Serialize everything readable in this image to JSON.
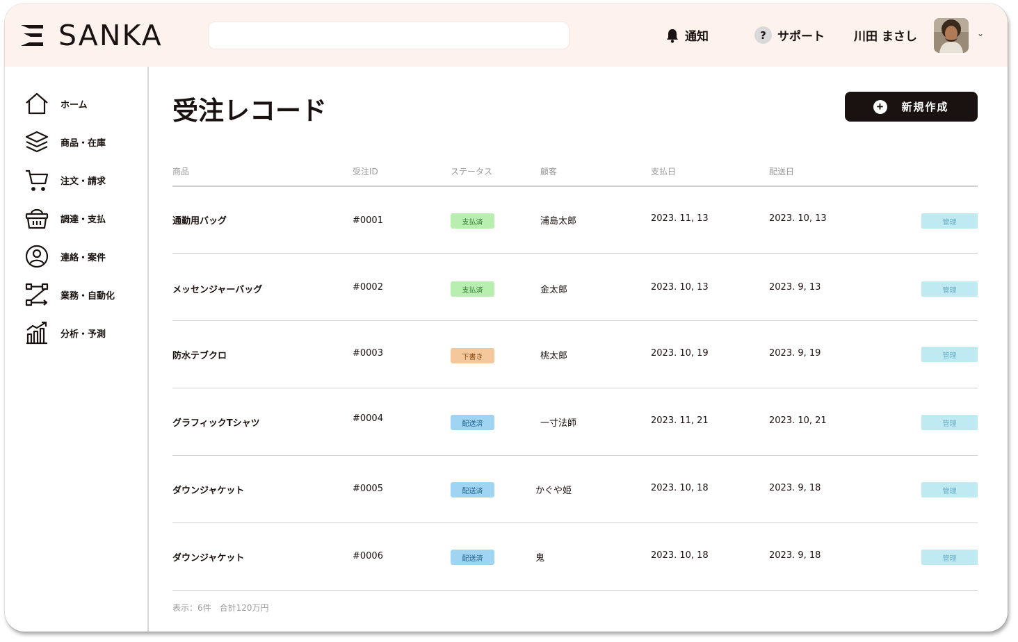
{
  "header": {
    "brand": "SANKA",
    "search": {
      "value": "",
      "placeholder": ""
    },
    "notifications_label": "通知",
    "support_label": "サポート",
    "user_name": "川田 まさし"
  },
  "sidebar": {
    "items": [
      {
        "label": "ホーム",
        "icon": "home-icon"
      },
      {
        "label": "商品・在庫",
        "icon": "layers-icon"
      },
      {
        "label": "注文・請求",
        "icon": "cart-icon"
      },
      {
        "label": "調達・支払",
        "icon": "basket-icon"
      },
      {
        "label": "連絡・案件",
        "icon": "user-circle-icon"
      },
      {
        "label": "業務・自動化",
        "icon": "workflow-icon"
      },
      {
        "label": "分析・予測",
        "icon": "chart-icon"
      }
    ]
  },
  "main": {
    "title": "受注レコード",
    "new_button_label": "新規作成",
    "columns": [
      "商品",
      "受注ID",
      "ステータス",
      "顧客",
      "支払日",
      "配送日"
    ],
    "rows": [
      {
        "product": "通勤用バッグ",
        "id": "#0001",
        "status": "支払済",
        "status_type": "paid",
        "customer": "浦島太郎",
        "paid_date": "2023. 11, 13",
        "ship_date": "2023. 10, 13",
        "action": "管理"
      },
      {
        "product": "メッセンジャーバッグ",
        "id": "#0002",
        "status": "支払済",
        "status_type": "paid",
        "customer": "金太郎",
        "paid_date": "2023. 10, 13",
        "ship_date": "2023. 9, 13",
        "action": "管理"
      },
      {
        "product": "防水テブクロ",
        "id": "#0003",
        "status": "下書き",
        "status_type": "draft",
        "customer": "桃太郎",
        "paid_date": "2023. 10, 19",
        "ship_date": "2023. 9, 19",
        "action": "管理"
      },
      {
        "product": "グラフィックTシャツ",
        "id": "#0004",
        "status": "配送済",
        "status_type": "shipped",
        "customer": "一寸法師",
        "paid_date": "2023. 11, 21",
        "ship_date": "2023. 10, 21",
        "action": "管理"
      },
      {
        "product": "ダウンジャケット",
        "id": "#0005",
        "status": "配送済",
        "status_type": "shipped",
        "customer": "かぐや姫",
        "paid_date": "2023. 10, 18",
        "ship_date": "2023. 9, 18",
        "action": "管理"
      },
      {
        "product": "ダウンジャケット",
        "id": "#0006",
        "status": "配送済",
        "status_type": "shipped",
        "customer": "鬼",
        "paid_date": "2023. 10, 18",
        "ship_date": "2023. 9, 18",
        "action": "管理"
      }
    ],
    "footer": "表示：6件　合計120万円"
  },
  "colors": {
    "header_bg": "#fdf2ee",
    "primary": "#1a1210",
    "paid": "#b8efb0",
    "draft": "#f4c89a",
    "shipped": "#9fd4f2",
    "manage": "#bfeaf2"
  }
}
